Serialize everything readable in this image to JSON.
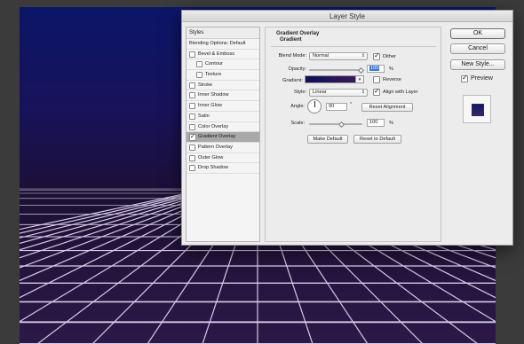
{
  "window": {
    "title": "Layer Style"
  },
  "styles_panel": {
    "header": "Styles",
    "blending_options": "Blending Options: Default",
    "items": [
      {
        "label": "Bevel & Emboss",
        "checked": false,
        "indent": false
      },
      {
        "label": "Contour",
        "checked": false,
        "indent": true
      },
      {
        "label": "Texture",
        "checked": false,
        "indent": true
      },
      {
        "label": "Stroke",
        "checked": false,
        "indent": false
      },
      {
        "label": "Inner Shadow",
        "checked": false,
        "indent": false
      },
      {
        "label": "Inner Glow",
        "checked": false,
        "indent": false
      },
      {
        "label": "Satin",
        "checked": false,
        "indent": false
      },
      {
        "label": "Color Overlay",
        "checked": false,
        "indent": false
      },
      {
        "label": "Gradient Overlay",
        "checked": true,
        "indent": false,
        "selected": true
      },
      {
        "label": "Pattern Overlay",
        "checked": false,
        "indent": false
      },
      {
        "label": "Outer Glow",
        "checked": false,
        "indent": false
      },
      {
        "label": "Drop Shadow",
        "checked": false,
        "indent": false
      }
    ]
  },
  "gradient_overlay": {
    "section_title": "Gradient Overlay",
    "group_title": "Gradient",
    "blend_mode_label": "Blend Mode:",
    "blend_mode_value": "Normal",
    "dither_label": "Dither",
    "dither_checked": true,
    "opacity_label": "Opacity:",
    "opacity_value": "100",
    "opacity_unit": "%",
    "gradient_label": "Gradient:",
    "reverse_label": "Reverse",
    "reverse_checked": false,
    "style_label": "Style:",
    "style_value": "Linear",
    "align_label": "Align with Layer",
    "align_checked": true,
    "angle_label": "Angle:",
    "angle_value": "90",
    "angle_unit": "°",
    "reset_alignment": "Reset Alignment",
    "scale_label": "Scale:",
    "scale_value": "100",
    "scale_unit": "%",
    "make_default": "Make Default",
    "reset_to_default": "Reset to Default"
  },
  "buttons": {
    "ok": "OK",
    "cancel": "Cancel",
    "new_style": "New Style..."
  },
  "preview": {
    "label": "Preview",
    "checked": true
  },
  "colors": {
    "canvas_top": "#0d1a6e",
    "canvas_bottom": "#2b1846",
    "grid_line": "#d9cfe6"
  }
}
